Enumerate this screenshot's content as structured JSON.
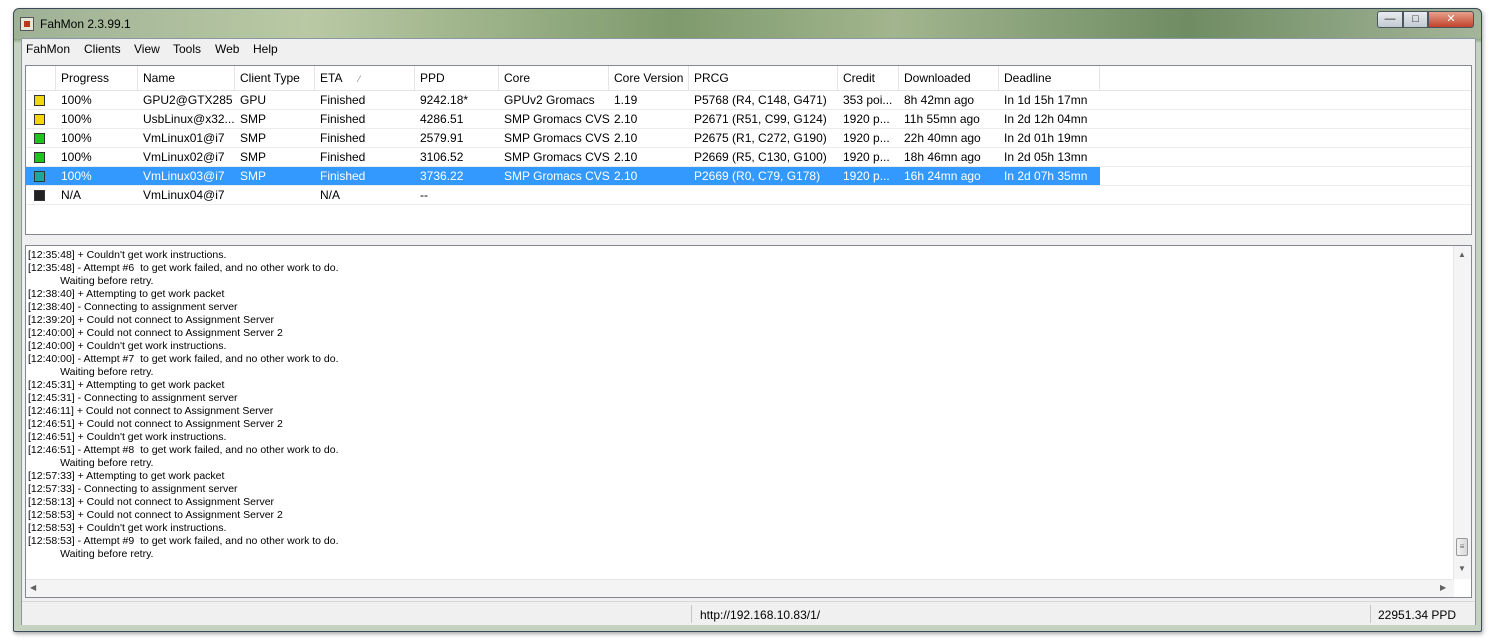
{
  "window": {
    "title": "FahMon 2.3.99.1",
    "controls": {
      "minimize": "—",
      "maximize": "□",
      "close": "✕"
    }
  },
  "menu": [
    "FahMon",
    "Clients",
    "View",
    "Tools",
    "Web",
    "Help"
  ],
  "grid": {
    "columns": [
      "Progress",
      "Name",
      "Client Type",
      "ETA",
      "PPD",
      "Core",
      "Core Version",
      "PRCG",
      "Credit",
      "Downloaded",
      "Deadline"
    ],
    "eta_sort_indicator": "⁄",
    "rows": [
      {
        "status_color": "#f5d60a",
        "progress": "100%",
        "name": "GPU2@GTX285",
        "type": "GPU",
        "eta": "Finished",
        "ppd": "9242.18*",
        "core": "GPUv2 Gromacs",
        "version": "1.19",
        "prcg": "P5768 (R4, C148, G471)",
        "credit": "353 poi...",
        "downloaded": "8h 42mn ago",
        "deadline": "In 1d 15h 17mn"
      },
      {
        "status_color": "#f5d60a",
        "progress": "100%",
        "name": "UsbLinux@x32...",
        "type": "SMP",
        "eta": "Finished",
        "ppd": "4286.51",
        "core": "SMP Gromacs CVS",
        "version": "2.10",
        "prcg": "P2671 (R51, C99, G124)",
        "credit": "1920 p...",
        "downloaded": "11h 55mn ago",
        "deadline": "In 2d 12h 04mn"
      },
      {
        "status_color": "#1fc41f",
        "progress": "100%",
        "name": "VmLinux01@i7",
        "type": "SMP",
        "eta": "Finished",
        "ppd": "2579.91",
        "core": "SMP Gromacs CVS",
        "version": "2.10",
        "prcg": "P2675 (R1, C272, G190)",
        "credit": "1920 p...",
        "downloaded": "22h 40mn ago",
        "deadline": "In 2d 01h 19mn"
      },
      {
        "status_color": "#1fc41f",
        "progress": "100%",
        "name": "VmLinux02@i7",
        "type": "SMP",
        "eta": "Finished",
        "ppd": "3106.52",
        "core": "SMP Gromacs CVS",
        "version": "2.10",
        "prcg": "P2669 (R5, C130, G100)",
        "credit": "1920 p...",
        "downloaded": "18h 46mn ago",
        "deadline": "In 2d 05h 13mn"
      },
      {
        "status_color": "#1aa89a",
        "progress": "100%",
        "name": "VmLinux03@i7",
        "type": "SMP",
        "eta": "Finished",
        "ppd": "3736.22",
        "core": "SMP Gromacs CVS",
        "version": "2.10",
        "prcg": "P2669 (R0, C79, G178)",
        "credit": "1920 p...",
        "downloaded": "16h 24mn ago",
        "deadline": "In 2d 07h 35mn",
        "selected": true
      },
      {
        "status_color": "#222222",
        "progress": "N/A",
        "name": "VmLinux04@i7",
        "type": "",
        "eta": "N/A",
        "ppd": "--",
        "core": "",
        "version": "",
        "prcg": "",
        "credit": "",
        "downloaded": "",
        "deadline": ""
      }
    ]
  },
  "log": [
    "[12:35:48] + Couldn't get work instructions.",
    "[12:35:48] - Attempt #6  to get work failed, and no other work to do.",
    "           Waiting before retry.",
    "[12:38:40] + Attempting to get work packet",
    "[12:38:40] - Connecting to assignment server",
    "[12:39:20] + Could not connect to Assignment Server",
    "[12:40:00] + Could not connect to Assignment Server 2",
    "[12:40:00] + Couldn't get work instructions.",
    "[12:40:00] - Attempt #7  to get work failed, and no other work to do.",
    "           Waiting before retry.",
    "[12:45:31] + Attempting to get work packet",
    "[12:45:31] - Connecting to assignment server",
    "[12:46:11] + Could not connect to Assignment Server",
    "[12:46:51] + Could not connect to Assignment Server 2",
    "[12:46:51] + Couldn't get work instructions.",
    "[12:46:51] - Attempt #8  to get work failed, and no other work to do.",
    "           Waiting before retry.",
    "[12:57:33] + Attempting to get work packet",
    "[12:57:33] - Connecting to assignment server",
    "[12:58:13] + Could not connect to Assignment Server",
    "[12:58:53] + Could not connect to Assignment Server 2",
    "[12:58:53] + Couldn't get work instructions.",
    "[12:58:53] - Attempt #9  to get work failed, and no other work to do.",
    "           Waiting before retry."
  ],
  "statusbar": {
    "url": "http://192.168.10.83/1/",
    "total_ppd": "22951.34 PPD"
  },
  "icons": {
    "scroll_up": "▲",
    "scroll_down": "▼",
    "scroll_left": "◀",
    "scroll_right": "▶",
    "grip": "≡"
  }
}
